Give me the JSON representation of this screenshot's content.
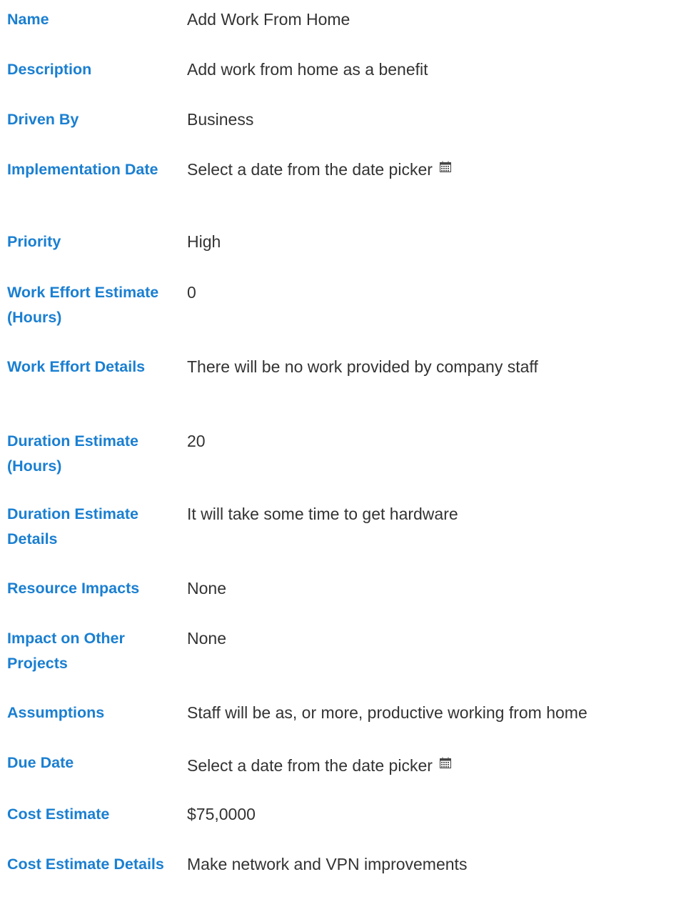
{
  "form": {
    "fields": {
      "name": {
        "label": "Name",
        "value": "Add Work From Home"
      },
      "description": {
        "label": "Description",
        "value": "Add work from home as a benefit"
      },
      "driven_by": {
        "label": "Driven By",
        "value": "Business"
      },
      "implementation_date": {
        "label": "Implementation Date",
        "value": "Select a date from the date picker",
        "icon": "calendar-icon"
      },
      "priority": {
        "label": "Priority",
        "value": "High"
      },
      "work_effort_estimate": {
        "label": "Work Effort Estimate (Hours)",
        "value": "0"
      },
      "work_effort_details": {
        "label": "Work Effort Details",
        "value": "There will be no work provided by company staff"
      },
      "duration_estimate": {
        "label": "Duration Estimate (Hours)",
        "value": "20"
      },
      "duration_estimate_details": {
        "label": "Duration Estimate Details",
        "value": "It will take some time to get hardware"
      },
      "resource_impacts": {
        "label": "Resource Impacts",
        "value": "None"
      },
      "impact_on_other_projects": {
        "label": "Impact on Other Projects",
        "value": "None"
      },
      "assumptions": {
        "label": "Assumptions",
        "value": "Staff will be as, or more, productive working from home"
      },
      "due_date": {
        "label": "Due Date",
        "value": "Select a date from the date picker",
        "icon": "calendar-icon"
      },
      "cost_estimate": {
        "label": "Cost Estimate",
        "value": "$75,0000"
      },
      "cost_estimate_details": {
        "label": "Cost Estimate Details",
        "value": "Make network and VPN improvements"
      }
    }
  },
  "colors": {
    "label": "#1a7fd1",
    "value": "#333333",
    "background": "#ffffff"
  }
}
